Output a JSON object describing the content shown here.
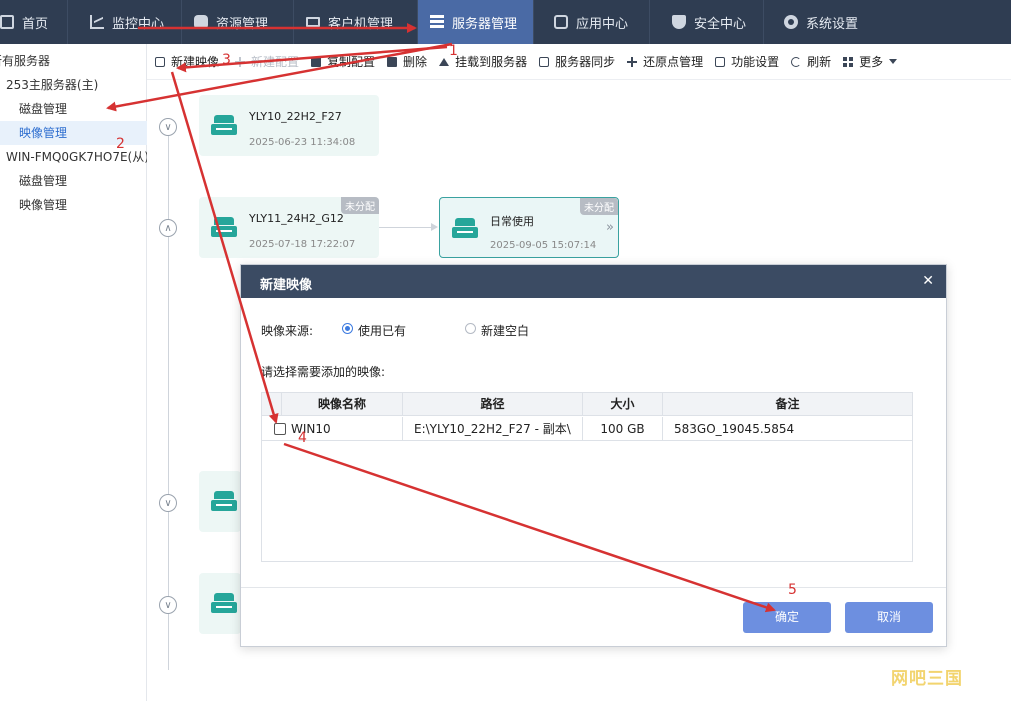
{
  "topnav": {
    "items": [
      {
        "label": "首页",
        "icon": "home-icon"
      },
      {
        "label": "监控中心",
        "icon": "chart-icon"
      },
      {
        "label": "资源管理",
        "icon": "resource-icon"
      },
      {
        "label": "客户机管理",
        "icon": "monitor-icon"
      },
      {
        "label": "服务器管理",
        "icon": "server-icon",
        "active": true
      },
      {
        "label": "应用中心",
        "icon": "app-icon"
      },
      {
        "label": "安全中心",
        "icon": "shield-icon"
      },
      {
        "label": "系统设置",
        "icon": "gear-icon"
      }
    ]
  },
  "sidebar": {
    "items": [
      {
        "label": "所有服务器"
      },
      {
        "label": "253主服务器(主)"
      },
      {
        "label": "磁盘管理"
      },
      {
        "label": "映像管理",
        "active": true
      },
      {
        "label": "WIN-FMQ0GK7HO7E(从)"
      },
      {
        "label": "磁盘管理"
      },
      {
        "label": "映像管理"
      }
    ]
  },
  "toolbar": {
    "new_image": "新建映像",
    "new_config": "新建配置",
    "copy_config": "复制配置",
    "delete": "删除",
    "mount": "挂载到服务器",
    "sync": "服务器同步",
    "restore": "还原点管理",
    "feature": "功能设置",
    "refresh": "刷新",
    "more": "更多"
  },
  "tree": {
    "nodes": [
      {
        "name": "YLY10_22H2_F27",
        "time": "2025-06-23 11:34:08"
      },
      {
        "name": "YLY11_24H2_G12",
        "time": "2025-07-18 17:22:07",
        "tag": "未分配"
      },
      {
        "name": "日常使用",
        "time": "2025-09-05 15:07:14",
        "tag": "未分配"
      }
    ]
  },
  "dialog": {
    "title": "新建映像",
    "source_label": "映像来源:",
    "opt_existing": "使用已有",
    "opt_blank": "新建空白",
    "prompt": "请选择需要添加的映像:",
    "columns": [
      "映像名称",
      "路径",
      "大小",
      "备注"
    ],
    "rows": [
      {
        "name": "WIN10",
        "path": "E:\\YLY10_22H2_F27 - 副本\\",
        "size": "100 GB",
        "note": "583GO_19045.5854"
      }
    ],
    "confirm": "确定",
    "cancel": "取消"
  },
  "annotations": [
    "1",
    "2",
    "3",
    "4",
    "5"
  ],
  "watermark": "网吧三国",
  "colors": {
    "nav_bg": "#2f3d52",
    "nav_active": "#4a6aa5",
    "accent": "#26a69a",
    "button": "#6d8fe0",
    "annotation": "#d63232"
  }
}
